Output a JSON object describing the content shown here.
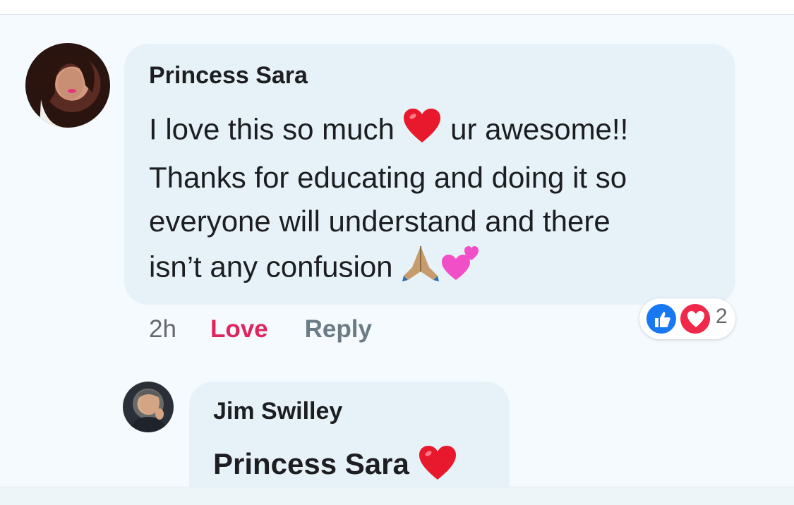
{
  "comments": [
    {
      "author": "Princess Sara",
      "text_line_1": "I love this so much",
      "text_after_heart": " ur awesome!!",
      "text_lines_2_3": "Thanks for educating and doing it so\neveryone will understand and there",
      "text_line_4": "isn’t any confusion",
      "emojis": [
        "red-heart",
        "folded-hands",
        "two-hearts"
      ],
      "timestamp": "2h",
      "love_label": "Love",
      "reply_label": "Reply",
      "reactions": {
        "types": [
          "like",
          "love"
        ],
        "count": "2"
      }
    },
    {
      "author": "Jim Swilley",
      "text": "Princess Sara",
      "emojis": [
        "red-heart"
      ]
    }
  ],
  "colors": {
    "background": "#f4fafd",
    "bubble": "#e7f2f8",
    "love_action": "#e0245e",
    "like_reaction": "#1877f2",
    "love_reaction": "#f0284a"
  }
}
